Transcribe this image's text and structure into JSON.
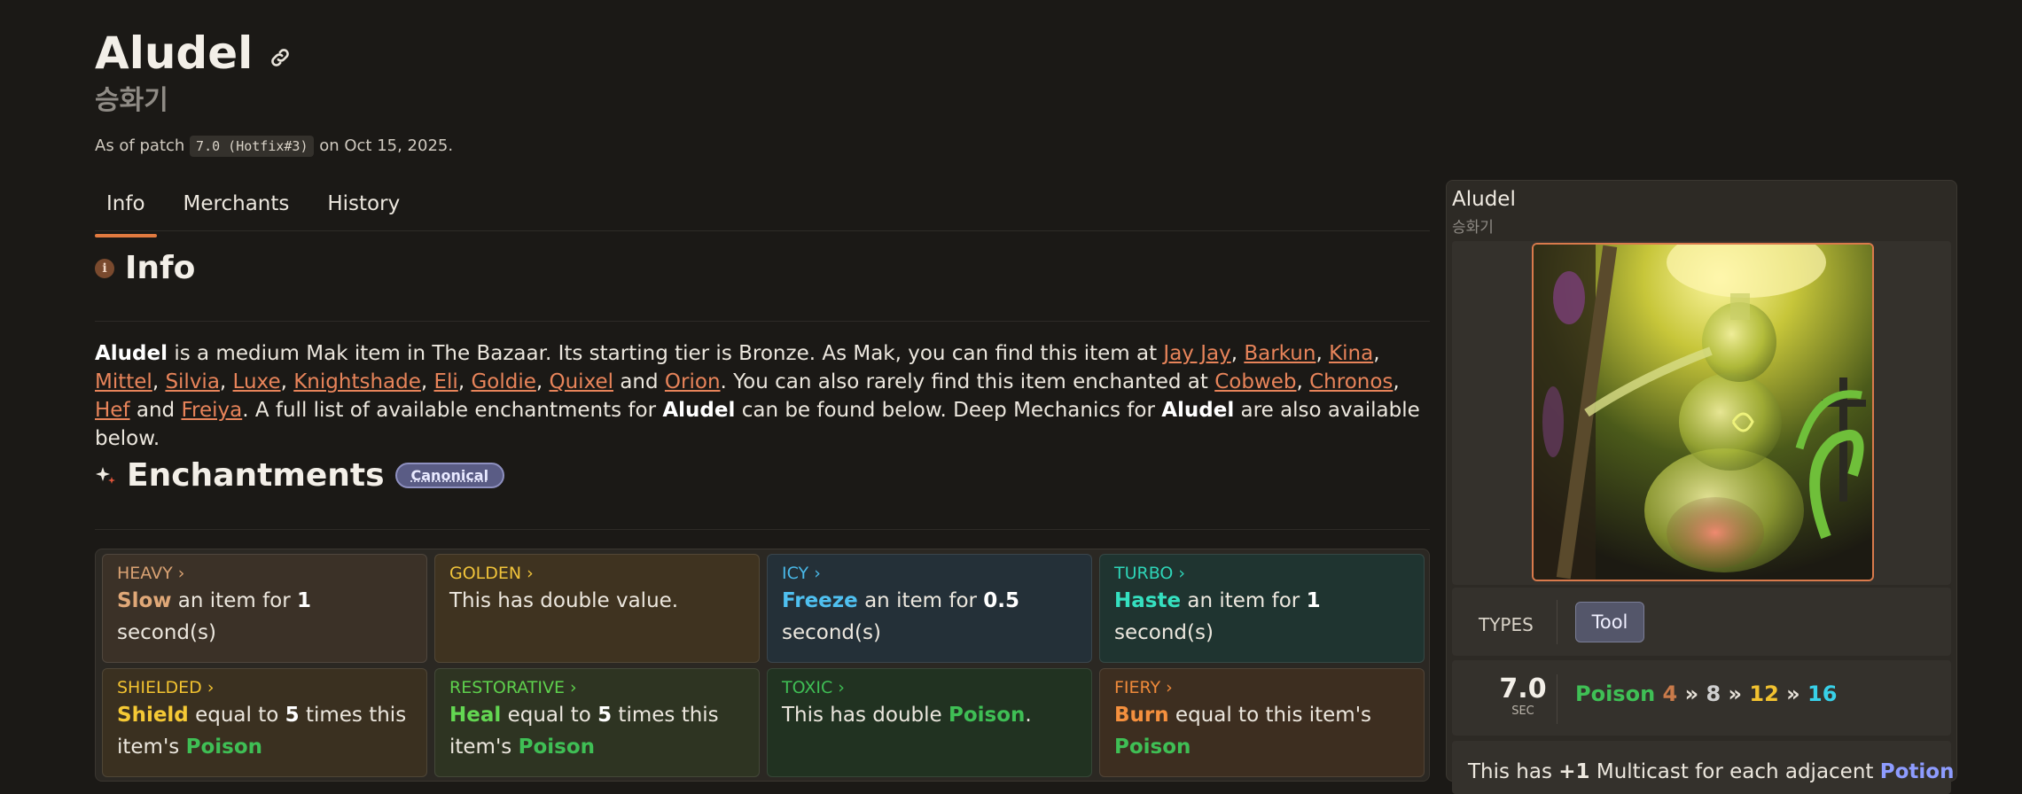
{
  "page": {
    "title": "Aludel",
    "subtitle": "승화기",
    "patch_prefix": "As of patch",
    "patch_version": "7.0 (Hotfix#3)",
    "patch_suffix": "on Oct 15, 2025."
  },
  "tabs": [
    {
      "label": "Info"
    },
    {
      "label": "Merchants"
    },
    {
      "label": "History"
    }
  ],
  "info": {
    "heading": "Info",
    "p": {
      "item": "Aludel",
      "t1": " is a medium Mak item in The Bazaar. Its starting tier is Bronze. As Mak, you can find this item at ",
      "merchants": [
        "Jay Jay",
        "Barkun",
        "Kina",
        "Mittel",
        "Silvia",
        "Luxe",
        "Knightshade",
        "Eli",
        "Goldie",
        "Quixel",
        "Orion"
      ],
      "and": "and",
      "t2": ". You can also rarely find this item enchanted at ",
      "enchanters": [
        "Cobweb",
        "Chronos",
        "Hef",
        "Freiya"
      ],
      "t3": ". A full list of available enchantments for ",
      "t4": " can be found below. Deep Mechanics for ",
      "t5": " are also available below."
    }
  },
  "enchantments": {
    "heading": "Enchantments",
    "badge": "Canonical",
    "cards": [
      {
        "name": "HEAVY",
        "kw": "Slow",
        "r1": " an item for ",
        "n": "1",
        "r2": " second(s)",
        "bg": "#3b3127",
        "nc": "#d9a273",
        "kc": "#e0a878"
      },
      {
        "name": "GOLDEN",
        "text": "This has double value.",
        "bg": "#3f3320",
        "nc": "#f0c33a"
      },
      {
        "name": "ICY",
        "kw": "Freeze",
        "r1": " an item for ",
        "n": "0.5",
        "r2": " second(s)",
        "bg": "#243038",
        "nc": "#49b8e8",
        "kc": "#4fc0f0"
      },
      {
        "name": "TURBO",
        "kw": "Haste",
        "r1": " an item for ",
        "n": "1",
        "r2": " second(s)",
        "bg": "#1f3430",
        "nc": "#2ed5b8",
        "kc": "#35e0c0"
      },
      {
        "name": "SHIELDED",
        "kw": "Shield",
        "r1": " equal to ",
        "n": "5",
        "r2": " times this item's ",
        "pois": "Poison",
        "bg": "#3a3020",
        "nc": "#f2c230",
        "kc": "#f5c935"
      },
      {
        "name": "RESTORATIVE",
        "kw": "Heal",
        "r1": " equal to ",
        "n": "5",
        "r2": " times this item's ",
        "pois": "Poison",
        "bg": "#2e3422",
        "nc": "#5ed14d",
        "kc": "#63d752"
      },
      {
        "name": "TOXIC",
        "text": "This has double ",
        "pois": "Poison",
        "end": ".",
        "bg": "#213221",
        "nc": "#3fbf55"
      },
      {
        "name": "FIERY",
        "kw": "Burn",
        "r1": " equal to this item's",
        "pois": "Poison",
        "bg": "#3d2e20",
        "nc": "#f08a3a",
        "kc": "#f5903e"
      }
    ]
  },
  "sidebar": {
    "title": "Aludel",
    "subtitle": "승화기",
    "types_label": "TYPES",
    "type": "Tool",
    "cooldown": "7.0",
    "cooldown_unit": "SEC",
    "poison_label": "Poison",
    "tiers": [
      "4",
      "8",
      "12",
      "16"
    ],
    "sep": "»",
    "desc_pre": "This has ",
    "desc_bold": "+1",
    "desc_mid": " Multicast for each adjacent ",
    "desc_kw": "Potion"
  },
  "colors": {
    "accent": "#e27a3f",
    "link": "#e8845a",
    "poison": "#3fbf55",
    "bronze": "#c97a4a",
    "silver": "#cfcfcf",
    "gold": "#f2c230",
    "diamond": "#38d0e8",
    "potion": "#8e9cff"
  }
}
